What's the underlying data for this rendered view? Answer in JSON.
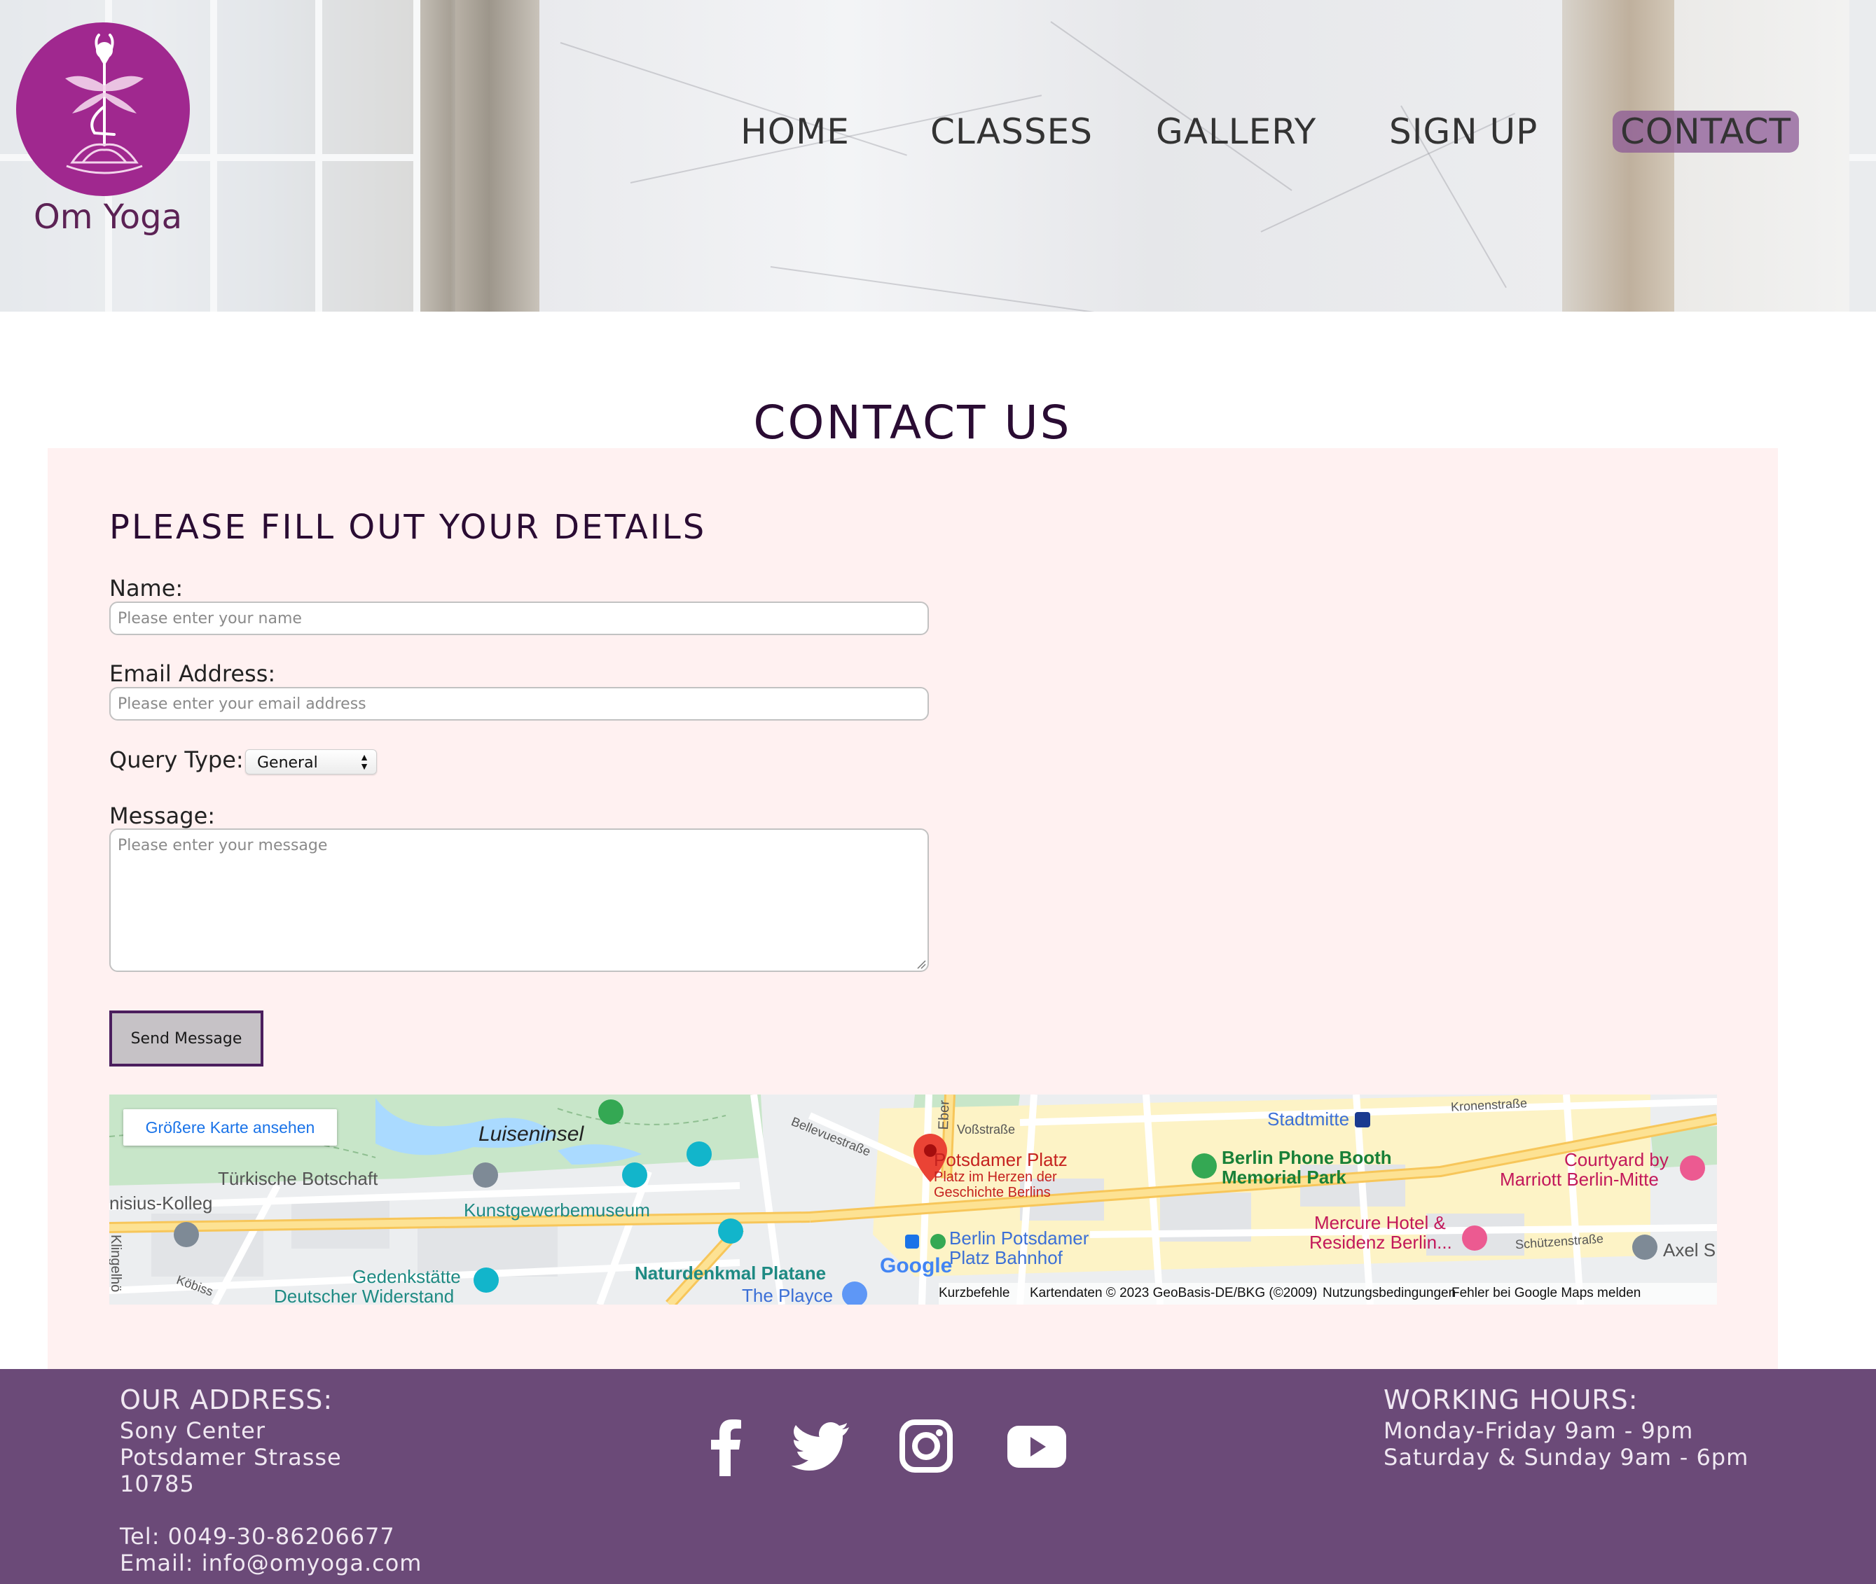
{
  "brand": {
    "name": "Om Yoga",
    "color": "#a0288f"
  },
  "nav": {
    "items": [
      {
        "label": "HOME",
        "active": false
      },
      {
        "label": "CLASSES",
        "active": false
      },
      {
        "label": "GALLERY",
        "active": false
      },
      {
        "label": "SIGN UP",
        "active": false
      },
      {
        "label": "CONTACT",
        "active": true
      }
    ],
    "active_color": "#8c5a96"
  },
  "page": {
    "title": "CONTACT US"
  },
  "form": {
    "heading": "PLEASE FILL OUT YOUR DETAILS",
    "name_label": "Name:",
    "name_placeholder": "Please enter your name",
    "email_label": "Email Address:",
    "email_placeholder": "Please enter your email address",
    "query_label": "Query Type:",
    "query_value": "General",
    "message_label": "Message:",
    "message_placeholder": "Please enter your message",
    "send_label": "Send Message",
    "panel_color": "#fff1f1"
  },
  "map": {
    "larger_map_label": "Größere Karte ansehen",
    "places": {
      "luiseninsel": "Luiseninsel",
      "turkish_embassy": "Türkische Botschaft",
      "canisius": "nisius-Kolleg",
      "kunstgewerbemuseum": "Kunstgewerbemuseum",
      "gedenkstaette_1": "Gedenkstätte",
      "gedenkstaette_2": "Deutscher Widerstand",
      "naturdenkmal": "Naturdenkmal Platane",
      "playce": "The Playce",
      "potsdamer_platz": "Potsdamer Platz",
      "potsdamer_platz_sub_1": "Platz im Herzen der",
      "potsdamer_platz_sub_2": "Geschichte Berlins",
      "bahnhof_1": "Berlin Potsdamer",
      "bahnhof_2": "Platz Bahnhof",
      "phone_booth_1": "Berlin Phone Booth",
      "phone_booth_2": "Memorial Park",
      "stadtmitte": "Stadtmitte",
      "courtyard_1": "Courtyard by",
      "courtyard_2": "Marriott Berlin-Mitte",
      "mercure_1": "Mercure Hotel &",
      "mercure_2": "Residenz Berlin...",
      "axel": "Axel S",
      "klingelhoefer": "Klingelhö",
      "koebis": "Köbiss",
      "vossstrasse": "Voßstraße",
      "bellevuestrasse": "Bellevuestraße",
      "ebert": "Eber",
      "kronenstrasse": "Kronenstraße",
      "schuetzenstrasse": "Schützenstraße"
    },
    "footer": {
      "shortcuts": "Kurzbefehle",
      "map_data": "Kartendaten © 2023 GeoBasis-DE/BKG (©2009)",
      "terms": "Nutzungsbedingungen",
      "report": "Fehler bei Google Maps melden"
    },
    "google": "Google"
  },
  "footer": {
    "address_heading": "OUR ADDRESS:",
    "address_line1": "Sony Center",
    "address_line2": "Potsdamer Strasse",
    "address_line3": "10785",
    "tel": "Tel: 0049-30-86206677",
    "email": "Email: info@omyoga.com",
    "hours_heading": "WORKING HOURS:",
    "hours_line1": "Monday-Friday 9am - 9pm",
    "hours_line2": "Saturday & Sunday 9am - 6pm",
    "social_icons": [
      "facebook-icon",
      "twitter-icon",
      "instagram-icon",
      "youtube-icon"
    ],
    "background": "#6b4a78"
  }
}
